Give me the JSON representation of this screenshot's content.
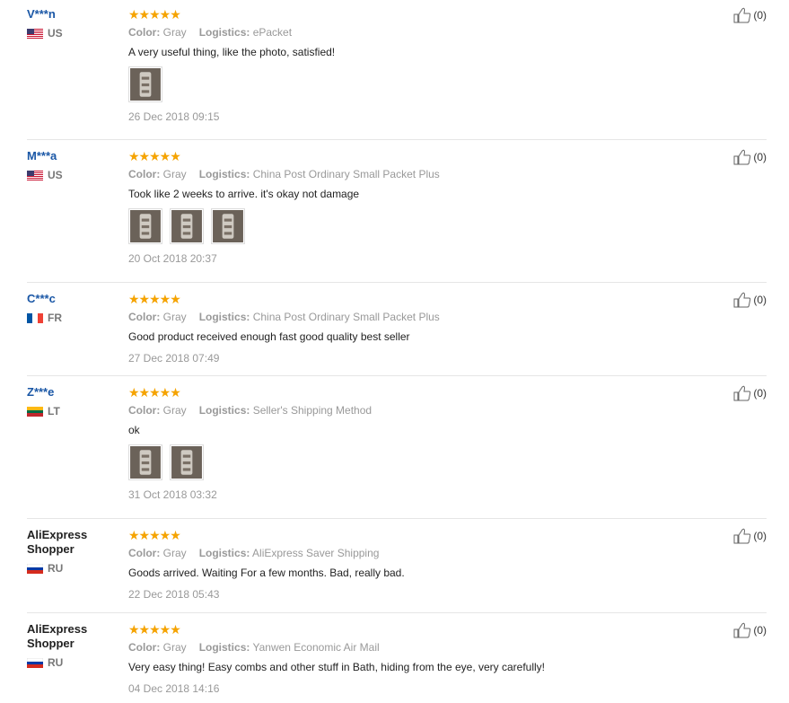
{
  "reviews": [
    {
      "name": "V***n",
      "country": "US",
      "flag": "us",
      "name_style": "blue",
      "rating": 5,
      "color_label": "Color:",
      "color": "Gray",
      "logistics_label": "Logistics:",
      "logistics": "ePacket",
      "text": "A very useful thing, like the photo, satisfied!",
      "photos": 1,
      "date": "26 Dec 2018 09:15",
      "likes": "(0)"
    },
    {
      "name": "M***a",
      "country": "US",
      "flag": "us",
      "name_style": "blue",
      "rating": 5,
      "color_label": "Color:",
      "color": "Gray",
      "logistics_label": "Logistics:",
      "logistics": "China Post Ordinary Small Packet Plus",
      "text": "Took like 2 weeks to arrive. it's okay not damage",
      "photos": 3,
      "date": "20 Oct 2018 20:37",
      "likes": "(0)"
    },
    {
      "name": "C***c",
      "country": "FR",
      "flag": "fr",
      "name_style": "blue",
      "rating": 5,
      "color_label": "Color:",
      "color": "Gray",
      "logistics_label": "Logistics:",
      "logistics": "China Post Ordinary Small Packet Plus",
      "text": "Good product received enough fast good quality best seller",
      "photos": 0,
      "date": "27 Dec 2018 07:49",
      "likes": "(0)"
    },
    {
      "name": "Z***e",
      "country": "LT",
      "flag": "lt",
      "name_style": "blue",
      "rating": 5,
      "color_label": "Color:",
      "color": "Gray",
      "logistics_label": "Logistics:",
      "logistics": "Seller's Shipping Method",
      "text": "ok",
      "photos": 2,
      "date": "31 Oct 2018 03:32",
      "likes": "(0)"
    },
    {
      "name": "AliExpress Shopper",
      "country": "RU",
      "flag": "ru",
      "name_style": "dark",
      "rating": 5,
      "color_label": "Color:",
      "color": "Gray",
      "logistics_label": "Logistics:",
      "logistics": "AliExpress Saver Shipping",
      "text": "Goods arrived. Waiting For a few months. Bad, really bad.",
      "photos": 0,
      "date": "22 Dec 2018 05:43",
      "likes": "(0)"
    },
    {
      "name": "AliExpress Shopper",
      "country": "RU",
      "flag": "ru",
      "name_style": "dark",
      "rating": 5,
      "color_label": "Color:",
      "color": "Gray",
      "logistics_label": "Logistics:",
      "logistics": "Yanwen Economic Air Mail",
      "text": "Very easy thing! Easy combs and other stuff in Bath, hiding from the eye, very carefully!",
      "photos": 0,
      "date": "04 Dec 2018 14:16",
      "likes": "(0)"
    }
  ],
  "colors": {
    "star": "#f5a300",
    "link": "#1a57a6",
    "muted": "#999999"
  }
}
